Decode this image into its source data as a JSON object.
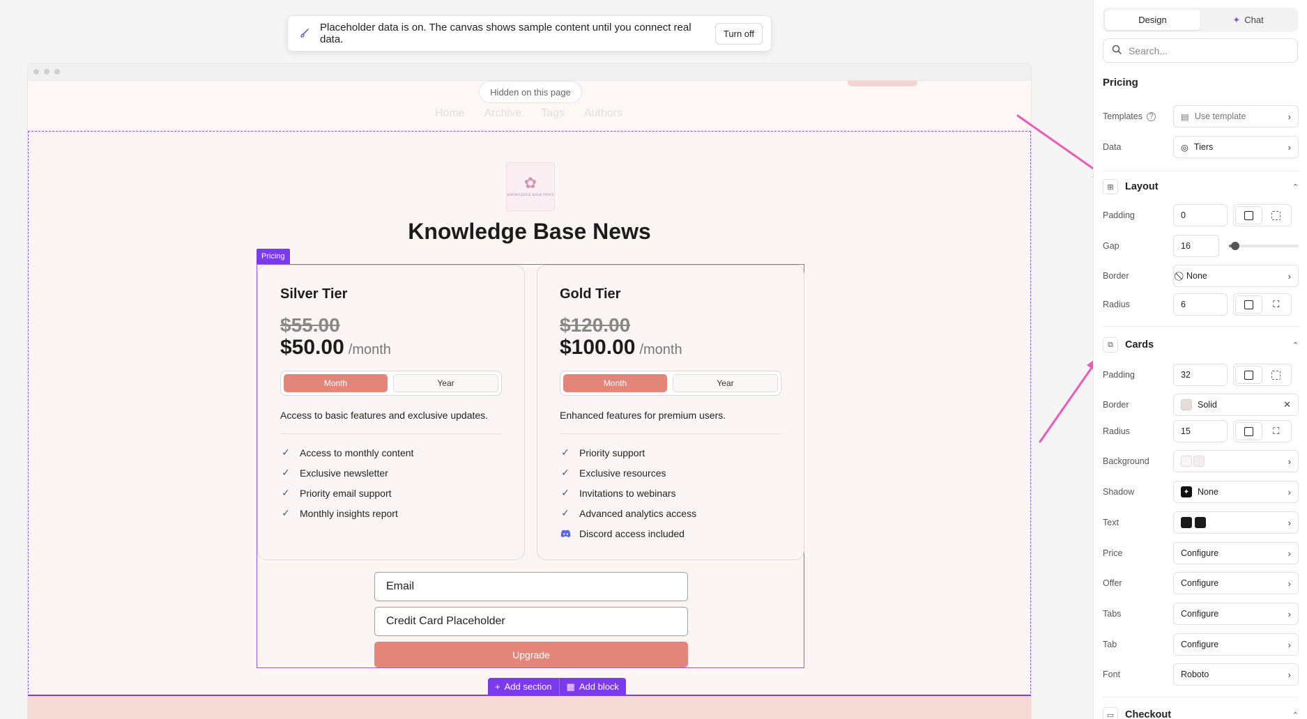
{
  "toast": {
    "message": "Placeholder data is on. The canvas shows sample content until you connect real data.",
    "button": "Turn off"
  },
  "header": {
    "hidden_badge": "Hidden on this page",
    "nav": [
      "Home",
      "Archive",
      "Tags",
      "Authors"
    ]
  },
  "site": {
    "logo_text": "KNOWLEDGE BASE NEWS",
    "title": "Knowledge Base News"
  },
  "pricing": {
    "tag": "Pricing",
    "cards": [
      {
        "name": "Silver Tier",
        "old_price": "$55.00",
        "price": "$50.00",
        "period": "/month",
        "tab_month": "Month",
        "tab_year": "Year",
        "description": "Access to basic features and exclusive updates.",
        "features": [
          "Access to monthly content",
          "Exclusive newsletter",
          "Priority email support",
          "Monthly insights report"
        ]
      },
      {
        "name": "Gold Tier",
        "old_price": "$120.00",
        "price": "$100.00",
        "period": "/month",
        "tab_month": "Month",
        "tab_year": "Year",
        "description": "Enhanced features for premium users.",
        "features": [
          "Priority support",
          "Exclusive resources",
          "Invitations to webinars",
          "Advanced analytics access",
          "Discord access included"
        ]
      }
    ],
    "checkout": {
      "email": "Email",
      "card": "Credit Card Placeholder",
      "button": "Upgrade"
    }
  },
  "add_bar": {
    "section": "Add section",
    "block": "Add block"
  },
  "panel": {
    "tabs": {
      "design": "Design",
      "chat": "Chat"
    },
    "search_placeholder": "Search...",
    "title": "Pricing",
    "templates": {
      "label": "Templates",
      "value": "Use template"
    },
    "data": {
      "label": "Data",
      "value": "Tiers"
    },
    "layout": {
      "heading": "Layout",
      "padding_label": "Padding",
      "padding": "0",
      "gap_label": "Gap",
      "gap": "16",
      "border_label": "Border",
      "border": "None",
      "radius_label": "Radius",
      "radius": "6"
    },
    "cards": {
      "heading": "Cards",
      "padding_label": "Padding",
      "padding": "32",
      "border_label": "Border",
      "border": "Solid",
      "radius_label": "Radius",
      "radius": "15",
      "background_label": "Background",
      "shadow_label": "Shadow",
      "shadow": "None",
      "text_label": "Text",
      "price_label": "Price",
      "price": "Configure",
      "offer_label": "Offer",
      "offer": "Configure",
      "tabs_label": "Tabs",
      "tabs": "Configure",
      "tab_label": "Tab",
      "tab": "Configure",
      "font_label": "Font",
      "font": "Roboto"
    },
    "checkout": {
      "heading": "Checkout"
    }
  },
  "colors": {
    "accent": "#7c3aed",
    "brand_coral": "#e4857a",
    "arrow": "#f058b8"
  }
}
